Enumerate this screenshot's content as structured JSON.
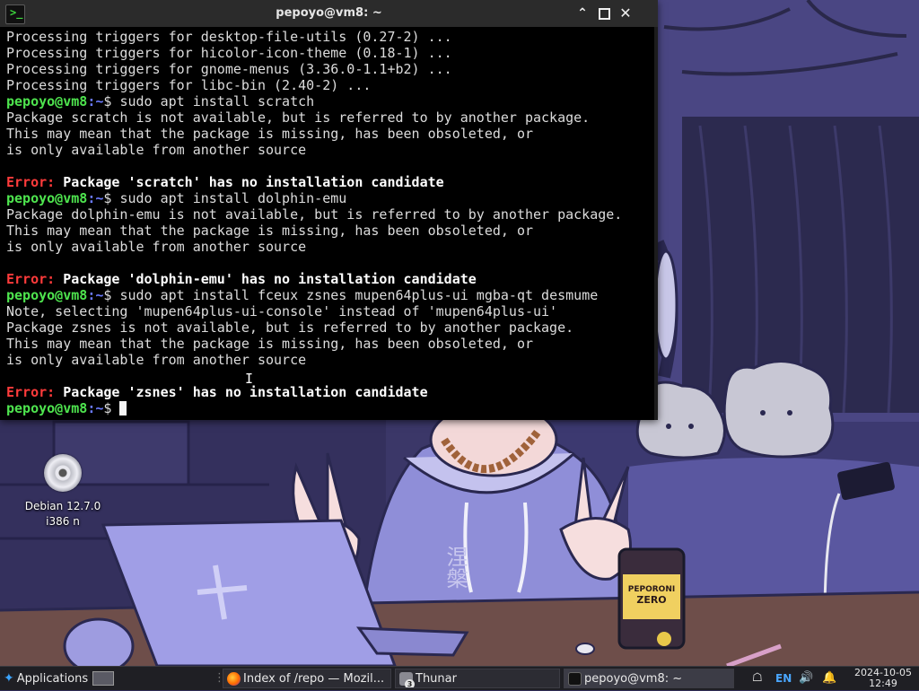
{
  "window": {
    "title": "pepoyo@vm8: ~",
    "icon": "terminal-icon"
  },
  "terminal": {
    "lines": [
      {
        "type": "plain",
        "text": "Processing triggers for desktop-file-utils (0.27-2) ..."
      },
      {
        "type": "plain",
        "text": "Processing triggers for hicolor-icon-theme (0.18-1) ..."
      },
      {
        "type": "plain",
        "text": "Processing triggers for gnome-menus (3.36.0-1.1+b2) ..."
      },
      {
        "type": "plain",
        "text": "Processing triggers for libc-bin (2.40-2) ..."
      },
      {
        "type": "prompt",
        "user": "pepoyo@vm8",
        "path": ":~",
        "sym": "$ ",
        "cmd": "sudo apt install scratch"
      },
      {
        "type": "plain",
        "text": "Package scratch is not available, but is referred to by another package."
      },
      {
        "type": "plain",
        "text": "This may mean that the package is missing, has been obsoleted, or"
      },
      {
        "type": "plain",
        "text": "is only available from another source"
      },
      {
        "type": "plain",
        "text": ""
      },
      {
        "type": "error",
        "label": "Error:",
        "text": " Package 'scratch' has no installation candidate"
      },
      {
        "type": "prompt",
        "user": "pepoyo@vm8",
        "path": ":~",
        "sym": "$ ",
        "cmd": "sudo apt install dolphin-emu"
      },
      {
        "type": "plain",
        "text": "Package dolphin-emu is not available, but is referred to by another package."
      },
      {
        "type": "plain",
        "text": "This may mean that the package is missing, has been obsoleted, or"
      },
      {
        "type": "plain",
        "text": "is only available from another source"
      },
      {
        "type": "plain",
        "text": ""
      },
      {
        "type": "error",
        "label": "Error:",
        "text": " Package 'dolphin-emu' has no installation candidate"
      },
      {
        "type": "prompt",
        "user": "pepoyo@vm8",
        "path": ":~",
        "sym": "$ ",
        "cmd": "sudo apt install fceux zsnes mupen64plus-ui mgba-qt desmume"
      },
      {
        "type": "plain",
        "text": "Note, selecting 'mupen64plus-ui-console' instead of 'mupen64plus-ui'"
      },
      {
        "type": "plain",
        "text": "Package zsnes is not available, but is referred to by another package."
      },
      {
        "type": "plain",
        "text": "This may mean that the package is missing, has been obsoleted, or"
      },
      {
        "type": "plain",
        "text": "is only available from another source"
      },
      {
        "type": "plain",
        "text": ""
      },
      {
        "type": "error",
        "label": "Error:",
        "text": " Package 'zsnes' has no installation candidate"
      },
      {
        "type": "prompt",
        "user": "pepoyo@vm8",
        "path": ":~",
        "sym": "$ ",
        "cmd": "",
        "cursor": true
      }
    ]
  },
  "desktop": {
    "icon_label_line1": "Debian 12.7.0",
    "icon_label_line2": "i386 n",
    "icon": "disc-icon",
    "wallpaper": {
      "can_text_1": "PEPORONI",
      "can_text_2": "ZERO",
      "hoodie_text": "涅槃"
    }
  },
  "taskbar": {
    "applications_label": "Applications",
    "tasks": [
      {
        "label": "Index of /repo — Mozil...",
        "icon": "firefox-icon"
      },
      {
        "label": "Thunar",
        "icon": "folder-icon",
        "badge": "3"
      },
      {
        "label": "pepoyo@vm8: ~",
        "icon": "terminal-icon"
      }
    ],
    "lang": "EN",
    "date": "2024-10-05",
    "time": "12:49"
  },
  "colors": {
    "prompt_user": "#4ee44e",
    "prompt_path": "#6b7bff",
    "error": "#ff3b3b",
    "terminal_bg": "#000000"
  }
}
